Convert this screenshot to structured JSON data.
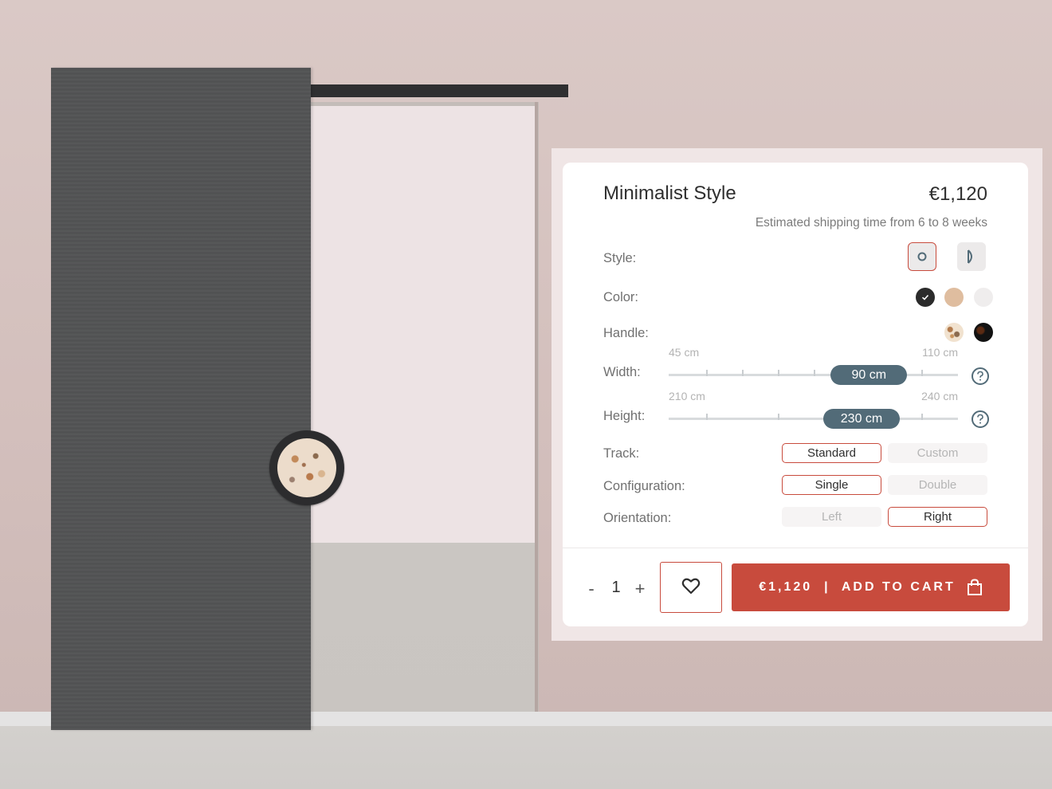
{
  "product": {
    "title": "Minimalist Style",
    "price": "€1,120",
    "shipping": "Estimated shipping time from 6 to 8 weeks"
  },
  "options": {
    "style": {
      "label": "Style:",
      "choices": [
        {
          "icon": "round-handle-icon",
          "selected": true
        },
        {
          "icon": "half-moon-handle-icon",
          "selected": false
        }
      ]
    },
    "color": {
      "label": "Color:",
      "swatches": [
        {
          "color": "#2b2b2b",
          "selected": true
        },
        {
          "color": "#dfbd9f",
          "selected": false
        },
        {
          "color": "#efeded",
          "selected": false
        }
      ]
    },
    "handle": {
      "label": "Handle:",
      "swatches": [
        {
          "name": "terrazzo",
          "selected": false
        },
        {
          "name": "dark-marble",
          "selected": false
        }
      ]
    },
    "width": {
      "label": "Width:",
      "min_label": "45 cm",
      "max_label": "110 cm",
      "min": 45,
      "max": 110,
      "value": 90,
      "value_label": "90 cm"
    },
    "height": {
      "label": "Height:",
      "min_label": "210 cm",
      "max_label": "240 cm",
      "min": 210,
      "max": 240,
      "value": 230,
      "value_label": "230 cm"
    },
    "track": {
      "label": "Track:",
      "choices": [
        "Standard",
        "Custom"
      ],
      "selected": "Standard"
    },
    "configuration": {
      "label": "Configuration:",
      "choices": [
        "Single",
        "Double"
      ],
      "selected": "Single"
    },
    "orientation": {
      "label": "Orientation:",
      "choices": [
        "Left",
        "Right"
      ],
      "selected": "Right"
    }
  },
  "cart": {
    "qty_minus": "-",
    "quantity": "1",
    "qty_plus": "+",
    "wishlist_icon": "heart-icon",
    "add_to_cart": "€1,120  |  ADD TO CART",
    "bag_icon": "shopping-bag-icon"
  },
  "colors": {
    "accent": "#c84b3d",
    "slider_thumb": "#526b78",
    "door": "#525354"
  }
}
